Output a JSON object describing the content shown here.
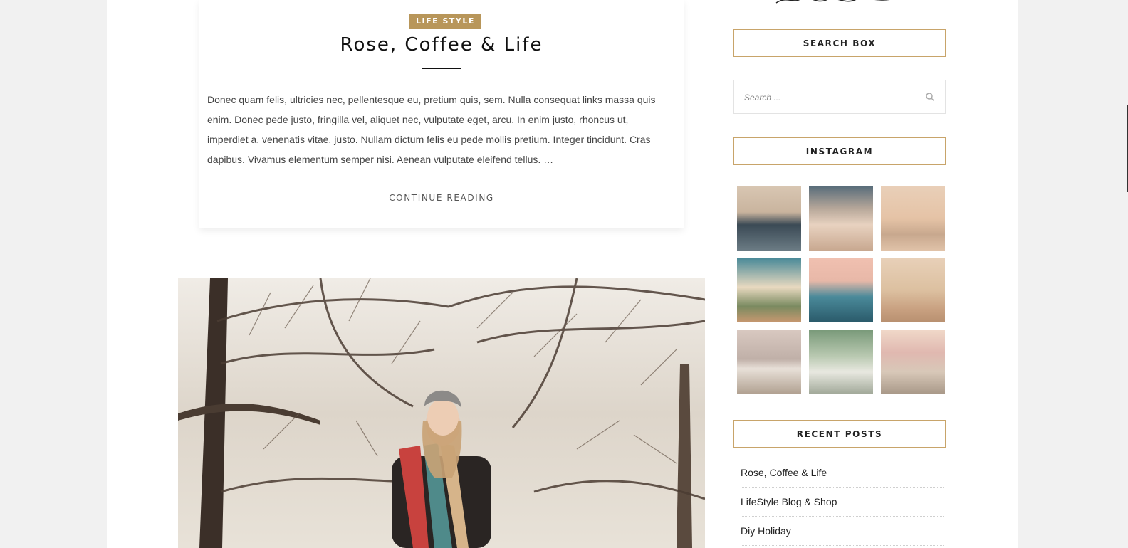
{
  "post": {
    "category": "LIFE STYLE",
    "title": "Rose, Coffee & Life",
    "excerpt": "Donec quam felis, ultricies nec, pellentesque eu, pretium quis, sem. Nulla consequat links massa quis enim. Donec pede justo, fringilla vel, aliquet nec, vulputate eget, arcu. In enim justo, rhoncus ut, imperdiet a, venenatis vitae, justo. Nullam dictum felis eu pede mollis pretium. Integer tincidunt. Cras dapibus. Vivamus elementum semper nisi. Aenean vulputate eleifend tellus. …",
    "continue_label": "CONTINUE READING",
    "badge_color": "#b8965a"
  },
  "sidebar": {
    "search": {
      "title": "SEARCH BOX",
      "placeholder": "Search ...",
      "icon": "search-icon"
    },
    "instagram": {
      "title": "INSTAGRAM",
      "photos": [
        "wine-glass-at-sea",
        "group-of-friends",
        "island-in-bay",
        "clouds-over-lake",
        "palm-mountain-pool",
        "hand-in-sunset",
        "horse-on-beach",
        "wedding-couple",
        "table-setting-flowers"
      ]
    },
    "recent_posts": {
      "title": "RECENT POSTS",
      "items": [
        "Rose, Coffee & Life",
        "LifeStyle Blog & Shop",
        "Diy Holiday"
      ]
    },
    "accent_color": "#c8a46a"
  }
}
